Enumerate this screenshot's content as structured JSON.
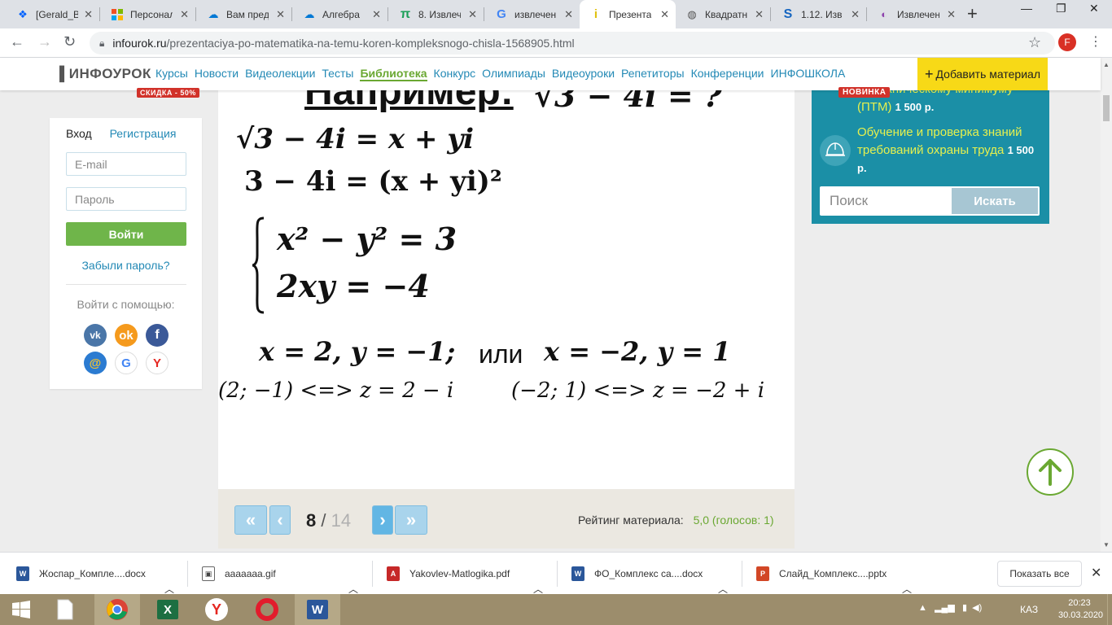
{
  "browser": {
    "tabs": [
      {
        "icon": "dropbox-icon",
        "label": "[Gerald_B"
      },
      {
        "icon": "microsoft-icon",
        "label": "Персонал"
      },
      {
        "icon": "cloud-icon",
        "label": "Вам пред"
      },
      {
        "icon": "cloud-icon",
        "label": "Алгебра"
      },
      {
        "icon": "pi-icon",
        "label": "8. Извлеч"
      },
      {
        "icon": "google-icon",
        "label": "извлечен"
      },
      {
        "icon": "infourok-icon",
        "label": "Презента"
      },
      {
        "icon": "globe-icon",
        "label": "Квадратн"
      },
      {
        "icon": "studfiles-icon",
        "label": "1.12. Изв"
      },
      {
        "icon": "search-icon",
        "label": "Извлечен"
      }
    ],
    "url_host": "infourok.ru",
    "url_path": "/prezentaciya-po-matematika-na-temu-koren-kompleksnogo-chisla-1568905.html",
    "profile_initial": "F"
  },
  "site": {
    "logo": "ИНФОУРОК",
    "sale_badge": "СКИДКА - 50%",
    "nav": [
      "Курсы",
      "Новости",
      "Видеолекции",
      "Тесты",
      "Библиотека",
      "Конкурс",
      "Олимпиады",
      "Видеоуроки",
      "Репетиторы",
      "Конференции",
      "ИНФОШКОЛА"
    ],
    "add_material": "Добавить материал"
  },
  "login": {
    "tab_login": "Вход",
    "tab_register": "Регистрация",
    "email_placeholder": "E-mail",
    "password_placeholder": "Пароль",
    "submit": "Войти",
    "forgot": "Забыли пароль?",
    "social_label": "Войти с помощью:"
  },
  "slide": {
    "title": "Например:",
    "title_expr": "√3 − 4i = ?",
    "line1": "√3 − 4i = x + yi",
    "line2": "3 − 4i = (x + yi)²",
    "sys1": "x² − y² = 3",
    "sys2": "2xy = −4",
    "sol_a": "x = 2, y = −1;",
    "sol_or": "или",
    "sol_b": "x = −2, y = 1",
    "res1": "(2; −1) <=> z = 2 − i",
    "res2": "(−2; 1) <=> z = −2 + i"
  },
  "pager": {
    "current": "8",
    "separator": "/",
    "total": "14",
    "rating_label": "Рейтинг материала:",
    "rating_value": "5,0 (голосов: 1)"
  },
  "side": {
    "badge": "НОВИНКА",
    "course1_text": "по техническому минимуму (ПТМ)",
    "course1_price": "1 500 р.",
    "course2_text": "Обучение и проверка знаний требований охраны труда",
    "course2_price": "1 500 р.",
    "search_placeholder": "Поиск",
    "search_button": "Искать"
  },
  "downloads": [
    {
      "name": "Жоспар_Комплe....docx",
      "type": "word"
    },
    {
      "name": "ааааааа.gif",
      "type": "image"
    },
    {
      "name": "Yakovlev-Matlogika.pdf",
      "type": "pdf"
    },
    {
      "name": "ФО_Комплекс са....docx",
      "type": "word"
    },
    {
      "name": "Слайд_Комплекс....pptx",
      "type": "ppt"
    }
  ],
  "show_all": "Показать все",
  "taskbar": {
    "lang": "КАЗ",
    "time": "20:23",
    "date": "30.03.2020"
  }
}
